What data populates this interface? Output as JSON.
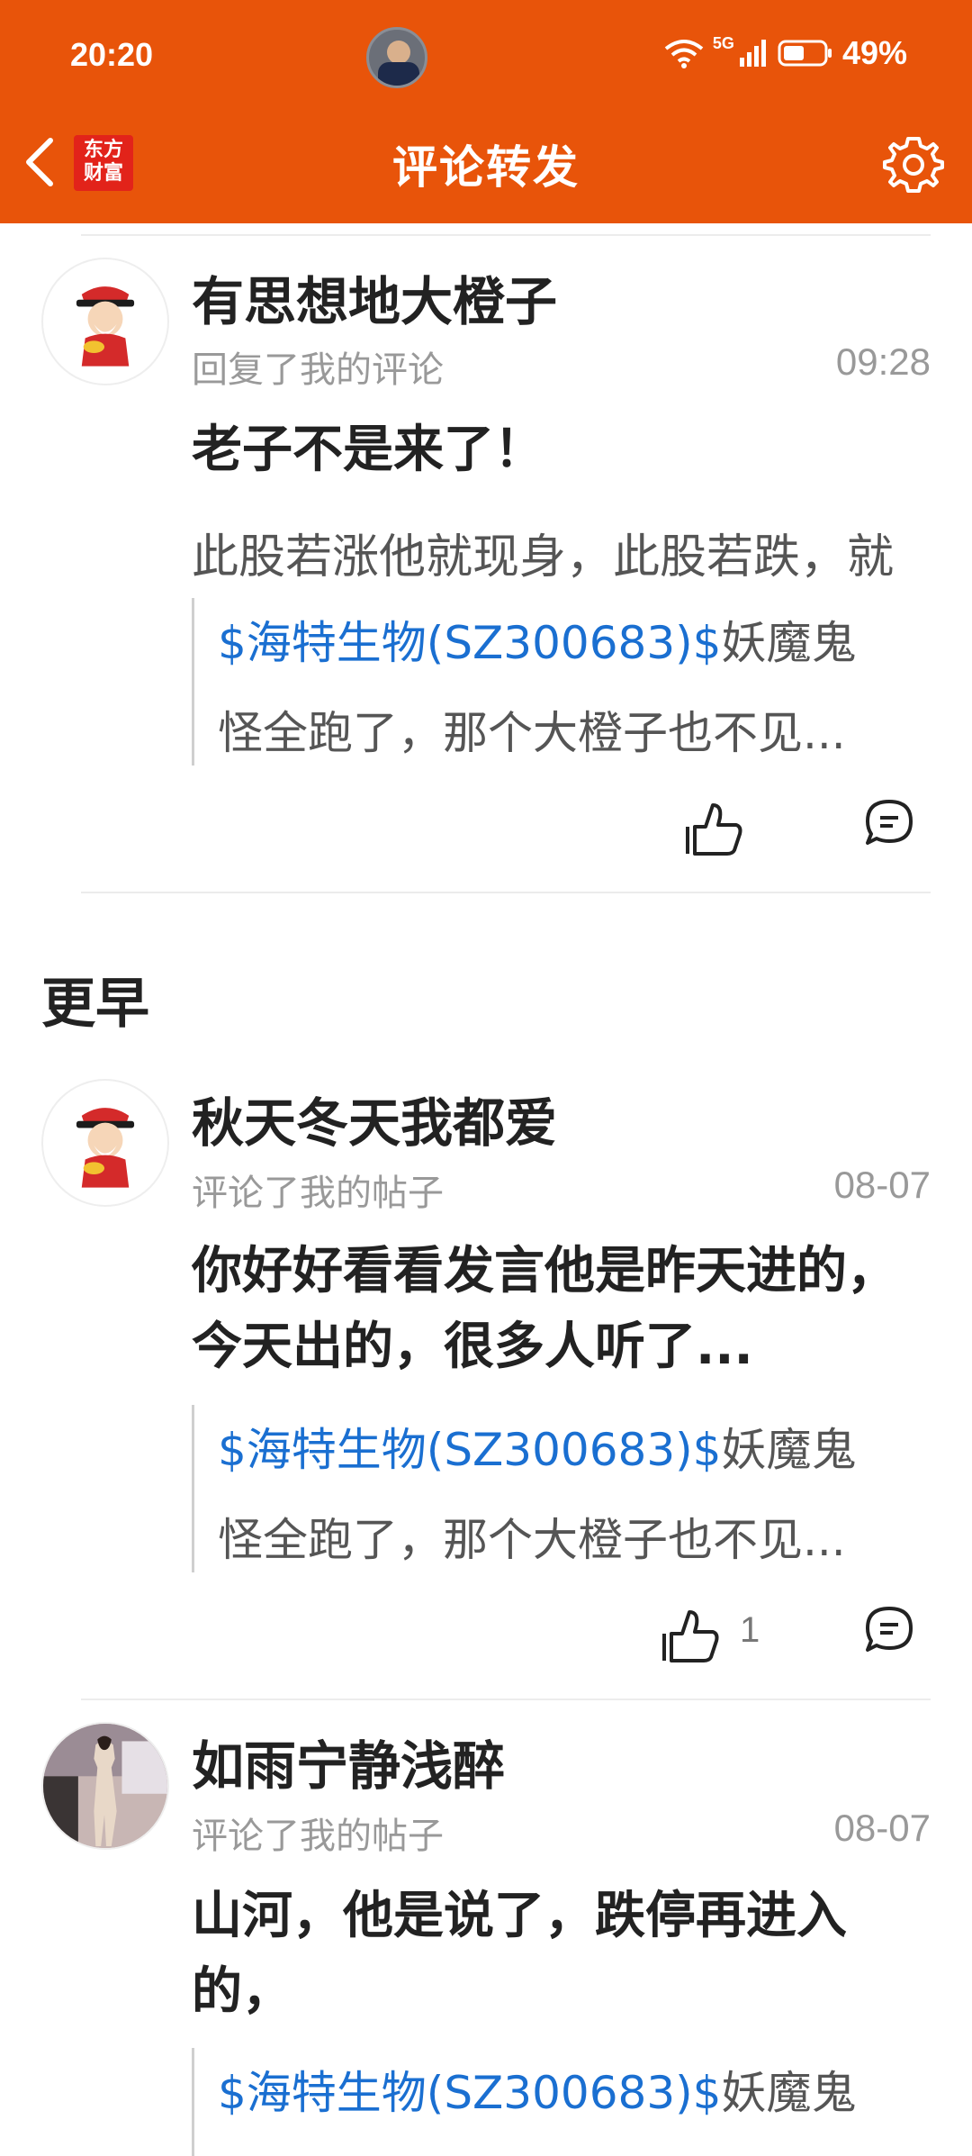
{
  "status_bar": {
    "time": "20:20",
    "network": "5G",
    "battery": "49%"
  },
  "nav": {
    "title": "评论转发",
    "logo_line1": "东方",
    "logo_line2": "财富"
  },
  "section_earlier": "更早",
  "items": [
    {
      "name": "有思想地大橙子",
      "action": "回复了我的评论",
      "time": "09:28",
      "comment": "老子不是来了！",
      "sub": "此股若涨他就现身，此股若跌，就",
      "quote_stock": "$海特生物(SZ300683)$",
      "quote_rest": "妖魔鬼",
      "quote_line2": "怪全跑了，那个大橙子也不见...",
      "like_count": ""
    },
    {
      "name": "秋天冬天我都爱",
      "action": "评论了我的帖子",
      "time": "08-07",
      "comment": "你好好看看发言他是昨天进的，今天出的，很多人听了...",
      "quote_stock": "$海特生物(SZ300683)$",
      "quote_rest": "妖魔鬼",
      "quote_line2": "怪全跑了，那个大橙子也不见...",
      "like_count": "1"
    },
    {
      "name": "如雨宁静浅醉",
      "action": "评论了我的帖子",
      "time": "08-07",
      "comment": "山河，他是说了，跌停再进入的，",
      "quote_stock": "$海特生物(SZ300683)$",
      "quote_rest": "妖魔鬼"
    }
  ],
  "colors": {
    "brand": "#E8540A",
    "stock_link": "#1a6fd1"
  }
}
